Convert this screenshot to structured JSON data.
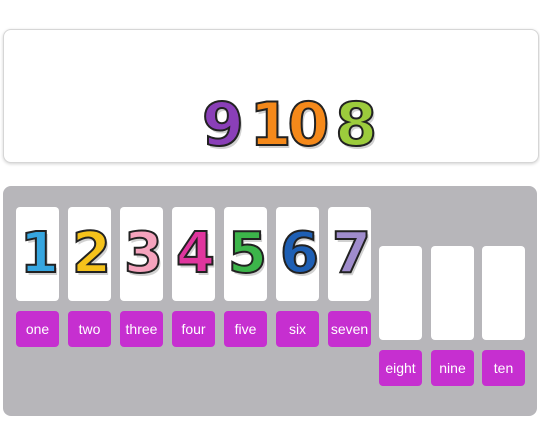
{
  "pool": {
    "numbers": [
      {
        "value": "9",
        "color": "#8a3fb8"
      },
      {
        "value": "10",
        "color": "#f5891a"
      },
      {
        "value": "8",
        "color": "#9ccc3c"
      }
    ]
  },
  "cards": [
    {
      "value": "1",
      "color": "#36a6e0",
      "label": "one"
    },
    {
      "value": "2",
      "color": "#f5c21b",
      "label": "two"
    },
    {
      "value": "3",
      "color": "#f5a3bd",
      "label": "three"
    },
    {
      "value": "4",
      "color": "#e0369e",
      "label": "four"
    },
    {
      "value": "5",
      "color": "#3cb54a",
      "label": "five"
    },
    {
      "value": "6",
      "color": "#1e5fb4",
      "label": "six"
    },
    {
      "value": "7",
      "color": "#9f8ccc",
      "label": "seven"
    }
  ],
  "slots": [
    {
      "label": "eight"
    },
    {
      "label": "nine"
    },
    {
      "label": "ten"
    }
  ],
  "colors": {
    "label_bg": "#c62fd0",
    "tray_bg": "#b7b6ba"
  }
}
